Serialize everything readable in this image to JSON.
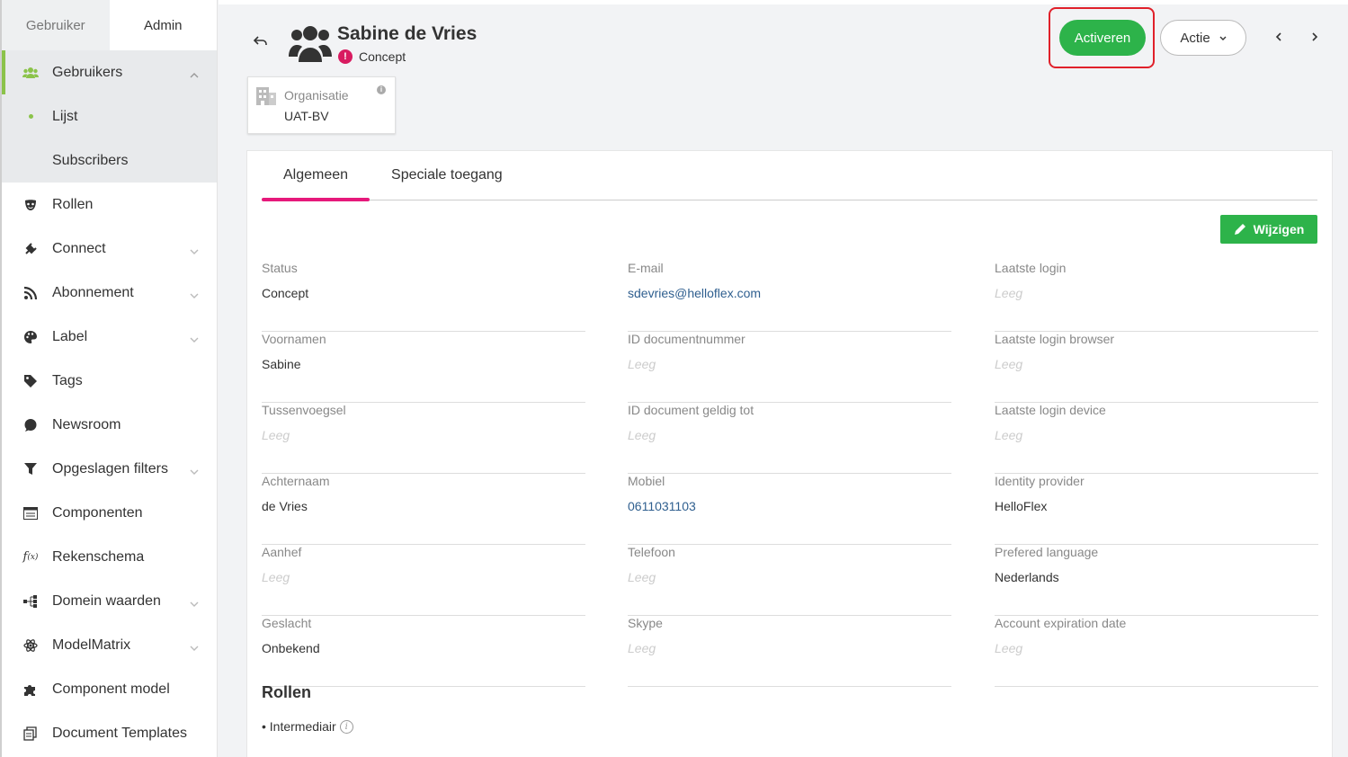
{
  "sidebar": {
    "tabs": [
      {
        "label": "Gebruiker",
        "active": false
      },
      {
        "label": "Admin",
        "active": true
      }
    ],
    "items": [
      {
        "label": "Gebruikers",
        "icon": "users-icon",
        "open": true
      },
      {
        "label": "Lijst",
        "sub": true,
        "active": true
      },
      {
        "label": "Subscribers",
        "sub": true
      },
      {
        "label": "Rollen",
        "icon": "mask-icon"
      },
      {
        "label": "Connect",
        "icon": "plug-icon",
        "chevron": true
      },
      {
        "label": "Abonnement",
        "icon": "rss-icon",
        "chevron": true
      },
      {
        "label": "Label",
        "icon": "palette-icon",
        "chevron": true
      },
      {
        "label": "Tags",
        "icon": "tag-icon"
      },
      {
        "label": "Newsroom",
        "icon": "chat-icon"
      },
      {
        "label": "Opgeslagen filters",
        "icon": "filter-icon",
        "chevron": true
      },
      {
        "label": "Componenten",
        "icon": "list-icon"
      },
      {
        "label": "Rekenschema",
        "icon": "function-icon"
      },
      {
        "label": "Domein waarden",
        "icon": "sitemap-icon",
        "chevron": true
      },
      {
        "label": "ModelMatrix",
        "icon": "atom-icon",
        "chevron": true
      },
      {
        "label": "Component model",
        "icon": "puzzle-icon"
      },
      {
        "label": "Document Templates",
        "icon": "copy-icon"
      }
    ]
  },
  "header": {
    "name": "Sabine de Vries",
    "status": "Concept",
    "org_label": "Organisatie",
    "org_value": "UAT-BV",
    "activate_label": "Activeren",
    "action_label": "Actie"
  },
  "tabs": [
    {
      "label": "Algemeen",
      "active": true
    },
    {
      "label": "Speciale toegang",
      "active": false
    }
  ],
  "edit_label": "Wijzigen",
  "empty_text": "Leeg",
  "fields": [
    [
      {
        "label": "Status",
        "value": "Concept"
      },
      {
        "label": "Voornamen",
        "value": "Sabine"
      },
      {
        "label": "Tussenvoegsel",
        "value": "Leeg",
        "empty": true
      },
      {
        "label": "Achternaam",
        "value": "de Vries"
      },
      {
        "label": "Aanhef",
        "value": "Leeg",
        "empty": true
      },
      {
        "label": "Geslacht",
        "value": "Onbekend"
      }
    ],
    [
      {
        "label": "E-mail",
        "value": "sdevries@helloflex.com",
        "link": true
      },
      {
        "label": "ID documentnummer",
        "value": "Leeg",
        "empty": true
      },
      {
        "label": "ID document geldig tot",
        "value": "Leeg",
        "empty": true
      },
      {
        "label": "Mobiel",
        "value": "0611031103",
        "link": true
      },
      {
        "label": "Telefoon",
        "value": "Leeg",
        "empty": true
      },
      {
        "label": "Skype",
        "value": "Leeg",
        "empty": true
      }
    ],
    [
      {
        "label": "Laatste login",
        "value": "Leeg",
        "empty": true
      },
      {
        "label": "Laatste login browser",
        "value": "Leeg",
        "empty": true
      },
      {
        "label": "Laatste login device",
        "value": "Leeg",
        "empty": true
      },
      {
        "label": "Identity provider",
        "value": "HelloFlex"
      },
      {
        "label": "Prefered language",
        "value": "Nederlands"
      },
      {
        "label": "Account expiration date",
        "value": "Leeg",
        "empty": true
      }
    ]
  ],
  "rollen": {
    "title": "Rollen",
    "items": [
      "• Intermediair"
    ]
  },
  "colors": {
    "accent": "#e6197b",
    "primary_button": "#2db34a",
    "sidebar_active": "#8bc34a",
    "status_dot": "#d81b60",
    "highlight": "#e0202a"
  }
}
